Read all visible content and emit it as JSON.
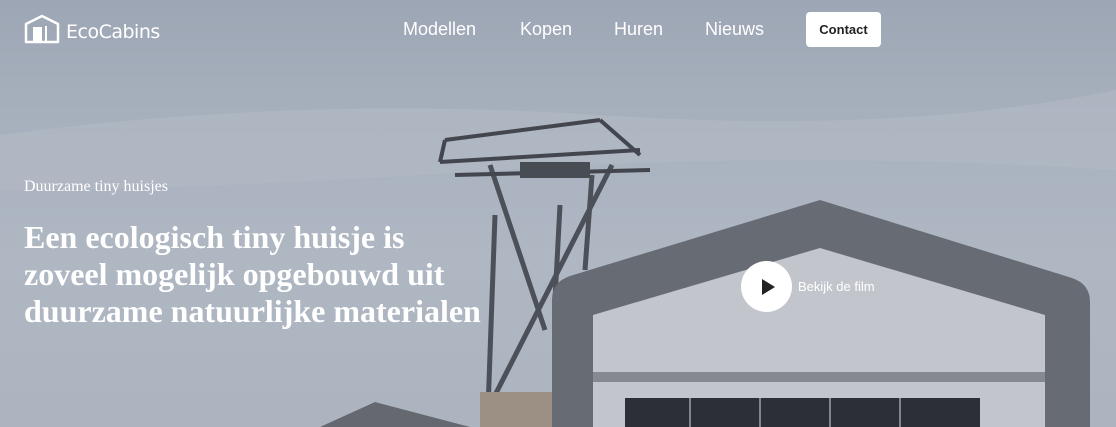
{
  "header": {
    "logo_text": "EcoCabins",
    "logo_icon": "cabin-icon",
    "nav": [
      "Modellen",
      "Kopen",
      "Huren",
      "Nieuws"
    ],
    "contact_label": "Contact"
  },
  "hero": {
    "subtitle": "Duurzame tiny huisjes",
    "headline": "Een ecologisch tiny huisje is zoveel mogelijk opgebouwd uit duurzame natuurlijke materialen",
    "video_label": "Bekijk de film",
    "video_icon": "play-icon"
  }
}
